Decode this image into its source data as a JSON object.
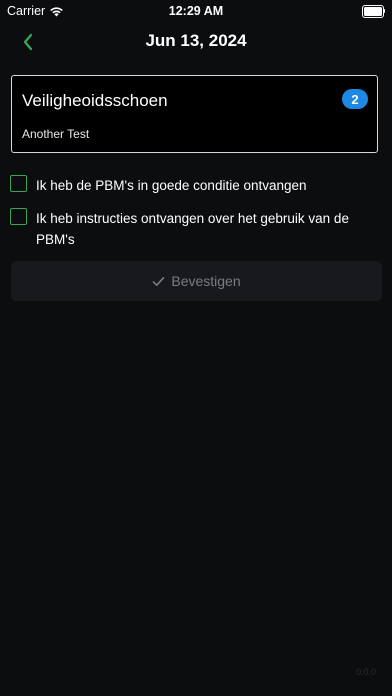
{
  "status_bar": {
    "carrier": "Carrier",
    "time": "12:29 AM"
  },
  "nav": {
    "title": "Jun 13, 2024",
    "back_icon": "chevron-left-icon",
    "accent_color": "#3aa35a"
  },
  "card": {
    "title": "Veiligheoidsschoen",
    "badge": "2",
    "badge_color": "#1e88e5",
    "subtitle": "Another Test"
  },
  "checklist": {
    "items": [
      {
        "label_lines": [
          "Ik heb de PBM's in goede conditie ontvangen"
        ],
        "checked": false
      },
      {
        "label_lines": [
          "Ik heb instructies ontvangen over het gebruik van de",
          "PBM's"
        ],
        "checked": false
      }
    ]
  },
  "confirm_button": {
    "icon": "checkmark-icon",
    "label": "Bevestigen",
    "enabled": false
  },
  "footer": {
    "version": "0.0.0"
  }
}
